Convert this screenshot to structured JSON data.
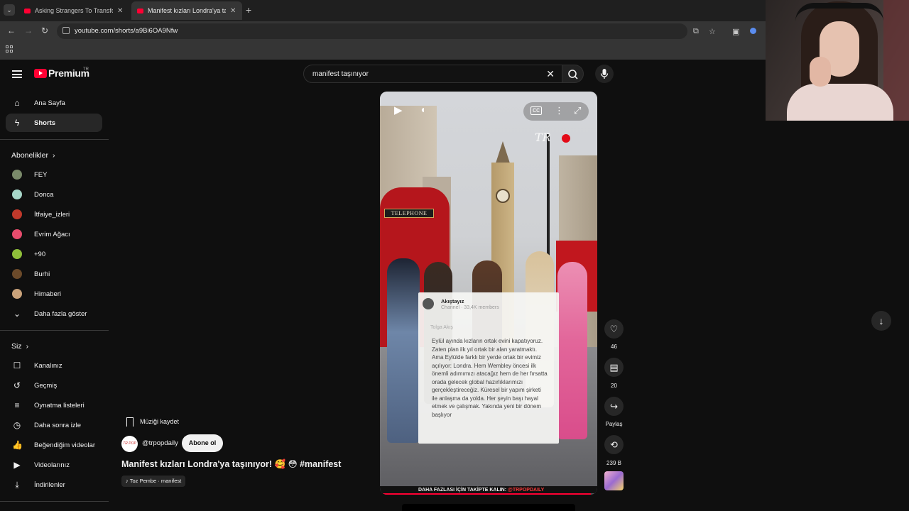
{
  "browser": {
    "tabs": [
      {
        "title": "Asking Strangers To Transform",
        "active": false
      },
      {
        "title": "Manifest kızları Londra'ya taşın",
        "active": true
      }
    ],
    "url": "youtube.com/shorts/a9Bi6OA9Nfw"
  },
  "youtube": {
    "logo_text": "Premium",
    "logo_region": "TR"
  },
  "sidebar": {
    "main": [
      {
        "label": "Ana Sayfa",
        "icon": "home-icon"
      },
      {
        "label": "Shorts",
        "icon": "shorts-icon",
        "active": true
      }
    ],
    "subscriptions_header": "Abonelikler",
    "subscriptions": [
      {
        "label": "FEY",
        "color": "#7a8a6a"
      },
      {
        "label": "Donca",
        "color": "#a7d6c8"
      },
      {
        "label": "İtfaiye_izleri",
        "color": "#c0392b"
      },
      {
        "label": "Evrim Ağacı",
        "color": "#e74c6d"
      },
      {
        "label": "+90",
        "color": "#8fbf3a"
      },
      {
        "label": "Burhi",
        "color": "#6b4a2a"
      },
      {
        "label": "Himaberi",
        "color": "#c9a27a"
      }
    ],
    "show_more": "Daha fazla göster",
    "you_header": "Siz",
    "you_items": [
      {
        "label": "Kanalınız",
        "icon": "account-box-icon"
      },
      {
        "label": "Geçmiş",
        "icon": "history-icon"
      },
      {
        "label": "Oynatma listeleri",
        "icon": "playlists-icon"
      },
      {
        "label": "Daha sonra izle",
        "icon": "watch-later-icon"
      },
      {
        "label": "Beğendiğim videolar",
        "icon": "thumb-up-icon"
      },
      {
        "label": "Videolarınız",
        "icon": "video-icon"
      },
      {
        "label": "İndirilenler",
        "icon": "download-icon"
      }
    ]
  },
  "search": {
    "query": "manifest taşınıyor"
  },
  "short": {
    "overlay": {
      "channel": "Akıştayız",
      "channel_sub": "Channel · 33,4K members",
      "author": "Tolga Akış",
      "body": "Eylül ayında kızların ortak evini kapatıyoruz. Zaten plan ilk yıl ortak bir alan yaratmaktı. Ama Eylülde farklı bir yerde ortak bir evimiz açılıyor: Londra. Hem Wembley öncesi ilk önemli adımımızı atacağız hem de her fırsatta orada gelecek global hazırlıklarımızı gerçekleştireceğiz. Küresel bir yapım şirketi ile anlaşma da yolda. Her şeyin başı hayal etmek ve çalışmak. Yakında yeni bir dönem başlıyor"
    },
    "booth_sign": "TELEPHONE",
    "watermark": "TR",
    "bottom_banner": "DAHA FAZLASI İÇİN TAKİPTE KALIN:",
    "bottom_banner_handle": "@TRPOPDAILY",
    "progress": 0.97,
    "actions": {
      "likes": "46",
      "comments": "20",
      "share": "Paylaş",
      "remix": "239 B"
    },
    "save_music": "Müziği kaydet",
    "channel": "@trpopdaily",
    "channel_avatar_text": "TR POP",
    "subscribe": "Abone ol",
    "title": "Manifest kızları Londra'ya taşınıyor! 🥰 😳 #manifest",
    "sound": "Toz Pembe · manifest"
  }
}
